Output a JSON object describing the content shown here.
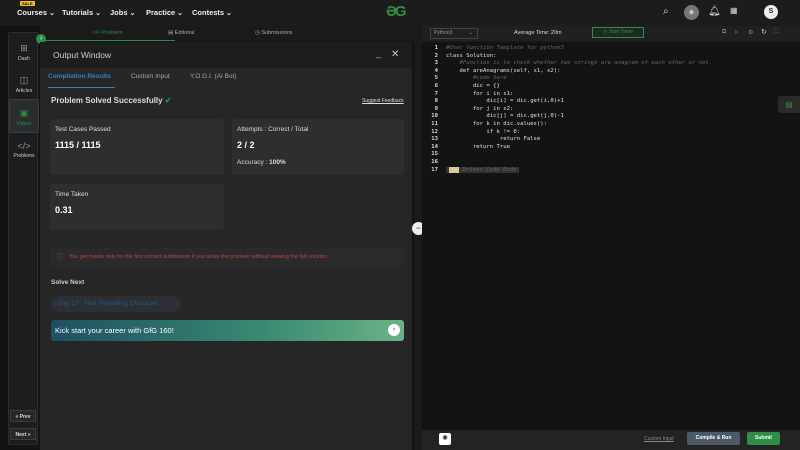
{
  "topnav": {
    "sale_badge": "SALE",
    "items": [
      "Courses",
      "Tutorials",
      "Jobs",
      "Practice",
      "Contests"
    ],
    "logo": "GfG",
    "avatar": "S"
  },
  "sidebar": {
    "items": [
      {
        "label": "Dash",
        "icon": "grid-icon"
      },
      {
        "label": "Articles",
        "icon": "book-icon"
      },
      {
        "label": "Videos",
        "icon": "video-icon"
      },
      {
        "label": "Problems",
        "icon": "code-icon"
      }
    ],
    "prev": "« Prev",
    "next": "Next »"
  },
  "problem_tabs": [
    "</> Problem",
    "Editorial",
    "Submissions"
  ],
  "output": {
    "title": "Output Window",
    "tabs": [
      "Compilation Results",
      "Custom Input",
      "Y.O.G.I. (AI Bot)"
    ],
    "status": "Problem Solved Successfully",
    "suggest": "Suggest Feedback",
    "test_label": "Test Cases Passed",
    "test_value": "1115 / 1115",
    "attempts_label": "Attempts : Correct / Total",
    "attempts_value": "2 / 2",
    "accuracy_label": "Accuracy :",
    "accuracy_value": "100%",
    "time_label": "Time Taken",
    "time_value": "0.31",
    "warning": "You get marks only for the first correct submission if you solve the problem without viewing the full solution.",
    "solve_next": "Solve Next",
    "next_problem": "Day 17 - Non Repeating Character",
    "banner": "Kick start your career with GfG 160!"
  },
  "editor": {
    "language": "Python3",
    "avg_time": "Average Time: 20m",
    "start_timer": "Start Timer",
    "lines": [
      "#User function Template for python3",
      "class Solution:",
      "    #Function is to check whether two strings are anagram of each other or not.",
      "    def areAnagrams(self, s1, s2):",
      "        #code here",
      "        dic = {}",
      "        for i in s1:",
      "            dic[i] = dic.get(i,0)+1",
      "        for j in s2:",
      "            dic[j] = dic.get(j,0)-1",
      "        for k in dic.values():",
      "            if k != 0:",
      "                return False",
      "        return True",
      "",
      "",
      "Driver Code Ends"
    ],
    "custom_input": "Custom Input",
    "compile": "Compile & Run",
    "submit": "Submit"
  },
  "colors": {
    "accent": "#2f8d46",
    "warning": "#c04545"
  }
}
